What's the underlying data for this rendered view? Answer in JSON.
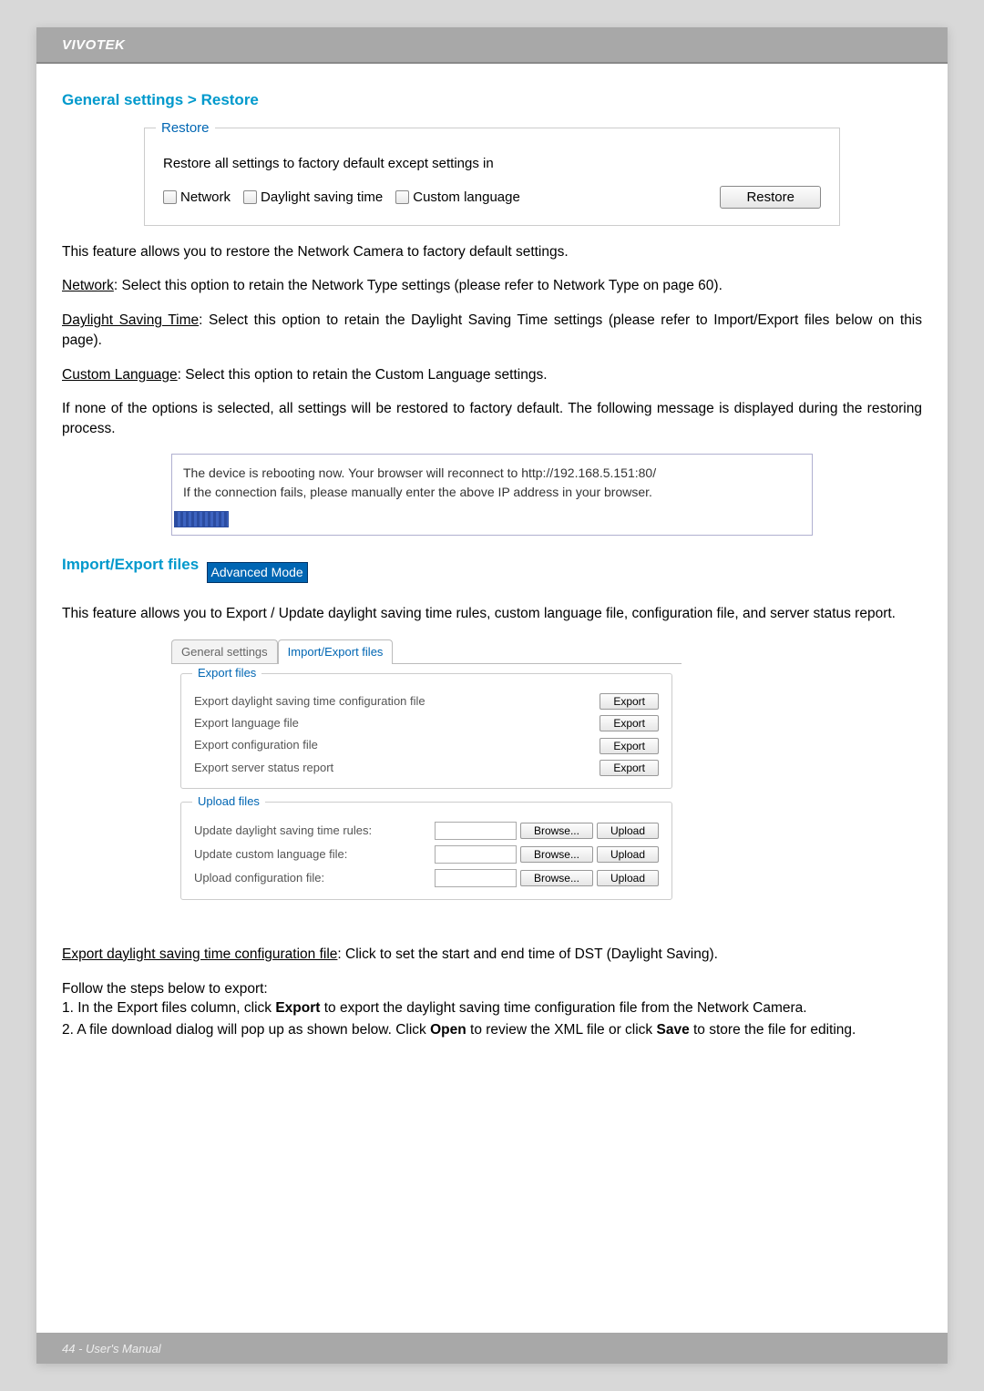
{
  "brand": "VIVOTEK",
  "section1_title": "General settings > Restore",
  "restore": {
    "legend": "Restore",
    "desc": "Restore all settings to factory default except settings in",
    "opts": [
      "Network",
      "Daylight saving time",
      "Custom language"
    ],
    "button": "Restore"
  },
  "p_intro": "This feature allows you to restore the Network Camera to factory default settings.",
  "p_net_label": "Network",
  "p_net_rest": ": Select this option to retain the Network Type settings (please refer to Network Type on page 60).",
  "p_dst_label": "Daylight Saving Time",
  "p_dst_rest": ": Select this option to retain the Daylight Saving Time settings (please refer to Import/Export files below on this page).",
  "p_cl_label": "Custom Language",
  "p_cl_rest": ": Select this option to retain the Custom Language settings.",
  "p_none": "If none of the options is selected, all settings will be restored to factory default.  The following message is displayed during the restoring process.",
  "reboot_l1": "The device is rebooting now. Your browser will reconnect to http://192.168.5.151:80/",
  "reboot_l2": "If the connection fails, please manually enter the above IP address in your browser.",
  "section2_title": "Import/Export files",
  "adv_badge": "Advanced Mode",
  "p_iex": "This feature allows you to Export / Update daylight saving time rules, custom language file, configuration file, and server status report.",
  "tabs": {
    "t1": "General settings",
    "t2": "Import/Export files"
  },
  "export_fs": {
    "legend": "Export files",
    "rows": [
      "Export daylight saving time configuration file",
      "Export language file",
      "Export configuration file",
      "Export server status report"
    ],
    "btn": "Export"
  },
  "upload_fs": {
    "legend": "Upload files",
    "rows": [
      "Update daylight saving time rules:",
      "Update custom language file:",
      "Upload configuration file:"
    ],
    "browse": "Browse...",
    "upload": "Upload"
  },
  "p_exp_label": "Export daylight saving time configuration file",
  "p_exp_rest": ": Click to set the start and end time of DST (Daylight Saving).",
  "steps_intro": "Follow the steps below to export:",
  "step1_pre": "1. In the Export files column, click ",
  "step1_bold": "Export",
  "step1_post": " to export the daylight saving time configuration file from the Network Camera.",
  "step2_pre": "2. A file download dialog will pop up as shown below. Click ",
  "step2_bold1": "Open",
  "step2_mid": " to review the XML file or click ",
  "step2_bold2": "Save",
  "step2_post": " to store the file for editing.",
  "footer": "44 - User's Manual"
}
